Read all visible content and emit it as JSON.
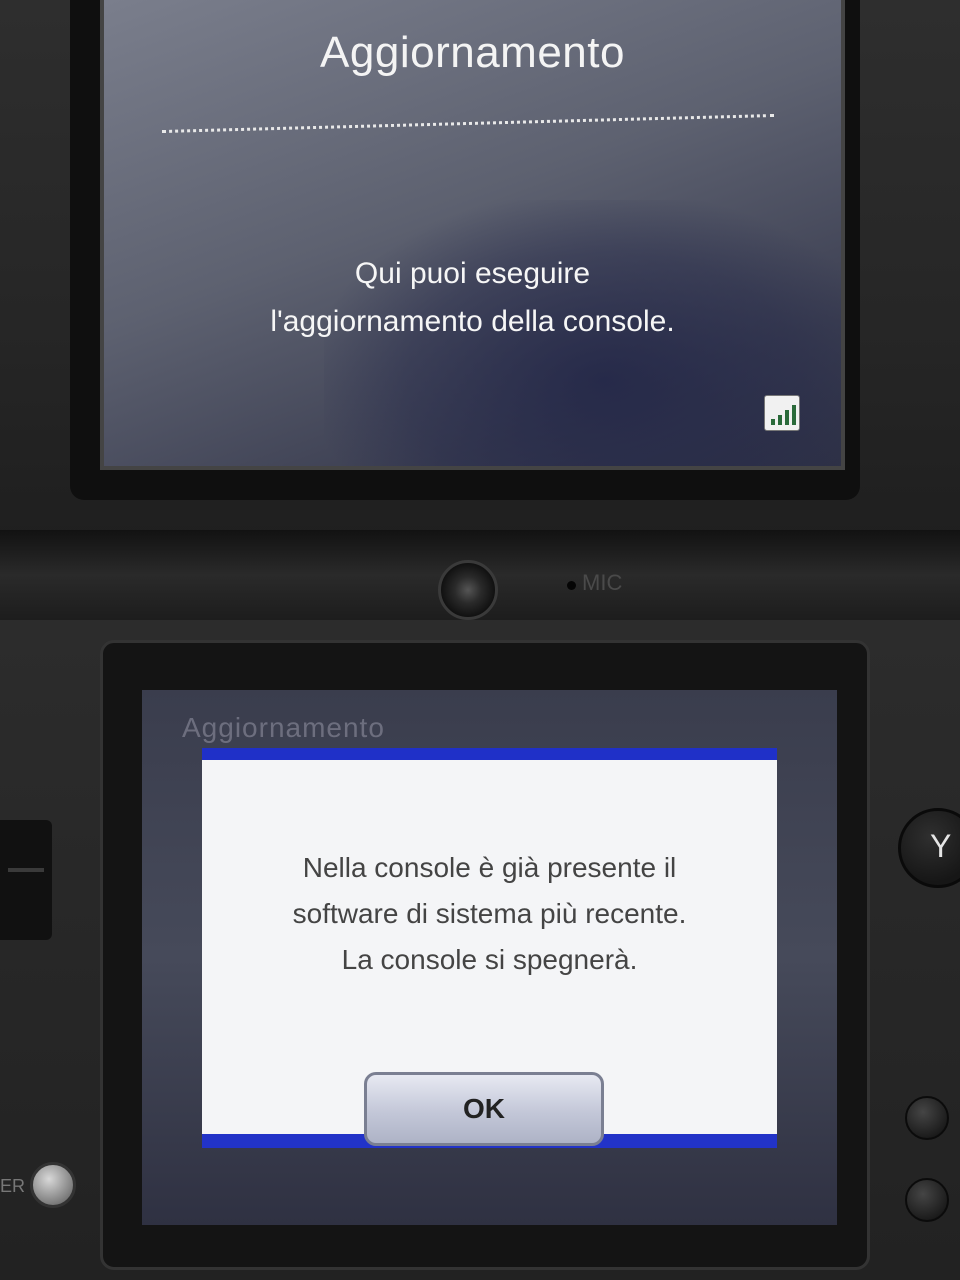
{
  "top_screen": {
    "title": "Aggiornamento",
    "message": "Qui puoi eseguire\nl'aggiornamento della console."
  },
  "device": {
    "mic_label": "MIC",
    "y_button_label": "Y",
    "power_label": "ER"
  },
  "bottom_screen": {
    "background_title": "Aggiornamento",
    "dialog": {
      "message": "Nella console è già presente il\nsoftware di sistema più recente.\nLa console si spegnerà.",
      "ok_label": "OK"
    }
  },
  "icons": {
    "signal": "signal-strength-icon"
  },
  "colors": {
    "dialog_accent": "#1f30c8",
    "dialog_background": "#f4f5f7",
    "top_screen_text": "#f4f4f4"
  }
}
